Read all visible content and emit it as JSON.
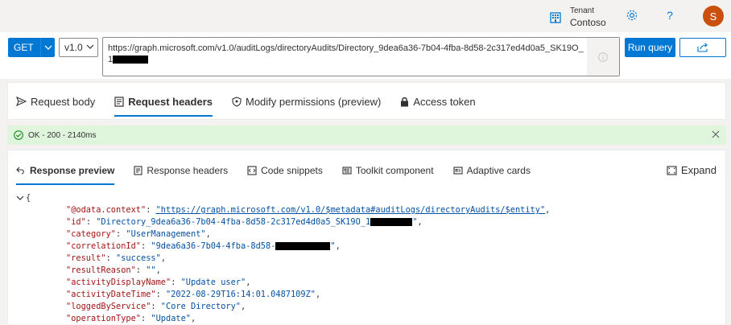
{
  "header": {
    "tenant_label": "Tenant",
    "tenant_name": "Contoso",
    "avatar_initial": "S",
    "avatar_color": "#ca5010"
  },
  "query": {
    "method": "GET",
    "version": "v1.0",
    "url": "https://graph.microsoft.com/v1.0/auditLogs/directoryAudits/Directory_9dea6a36-7b04-4fba-8d58-2c317ed4d0a5_SK19O_1",
    "run_label": "Run query",
    "accent": "#0078d4"
  },
  "request_tabs": [
    {
      "label": "Request body",
      "icon": "send-icon"
    },
    {
      "label": "Request headers",
      "icon": "document-icon"
    },
    {
      "label": "Modify permissions (preview)",
      "icon": "shield-icon"
    },
    {
      "label": "Access token",
      "icon": "lock-icon"
    }
  ],
  "status": {
    "text": "OK - 200 - 2140ms",
    "color": "#dff6dd"
  },
  "response_tabs": [
    {
      "label": "Response preview",
      "icon": "undo-icon"
    },
    {
      "label": "Response headers",
      "icon": "document-icon"
    },
    {
      "label": "Code snippets",
      "icon": "code-icon"
    },
    {
      "label": "Toolkit component",
      "icon": "toolkit-icon"
    },
    {
      "label": "Adaptive cards",
      "icon": "card-icon"
    }
  ],
  "expand_label": "Expand",
  "response": {
    "open_brace": "{",
    "lines": [
      {
        "key": "\"@odata.context\"",
        "value": "\"https://graph.microsoft.com/v1.0/$metadata#auditLogs/directoryAudits/$entity\"",
        "link": true
      },
      {
        "key": "\"id\"",
        "value": "\"Directory_9dea6a36-7b04-4fba-8d58-2c317ed4d0a5_SK19O_1",
        "value_end": "\"",
        "redacted": true
      },
      {
        "key": "\"category\"",
        "value": "\"UserManagement\""
      },
      {
        "key": "\"correlationId\"",
        "value": "\"9dea6a36-7b04-4fba-8d58-",
        "value_end": "\"",
        "redacted": true
      },
      {
        "key": "\"result\"",
        "value": "\"success\""
      },
      {
        "key": "\"resultReason\"",
        "value": "\"\""
      },
      {
        "key": "\"activityDisplayName\"",
        "value": "\"Update user\""
      },
      {
        "key": "\"activityDateTime\"",
        "value": "\"2022-08-29T16:14:01.0487109Z\""
      },
      {
        "key": "\"loggedByService\"",
        "value": "\"Core Directory\""
      },
      {
        "key": "\"operationType\"",
        "value": "\"Update\""
      }
    ]
  }
}
